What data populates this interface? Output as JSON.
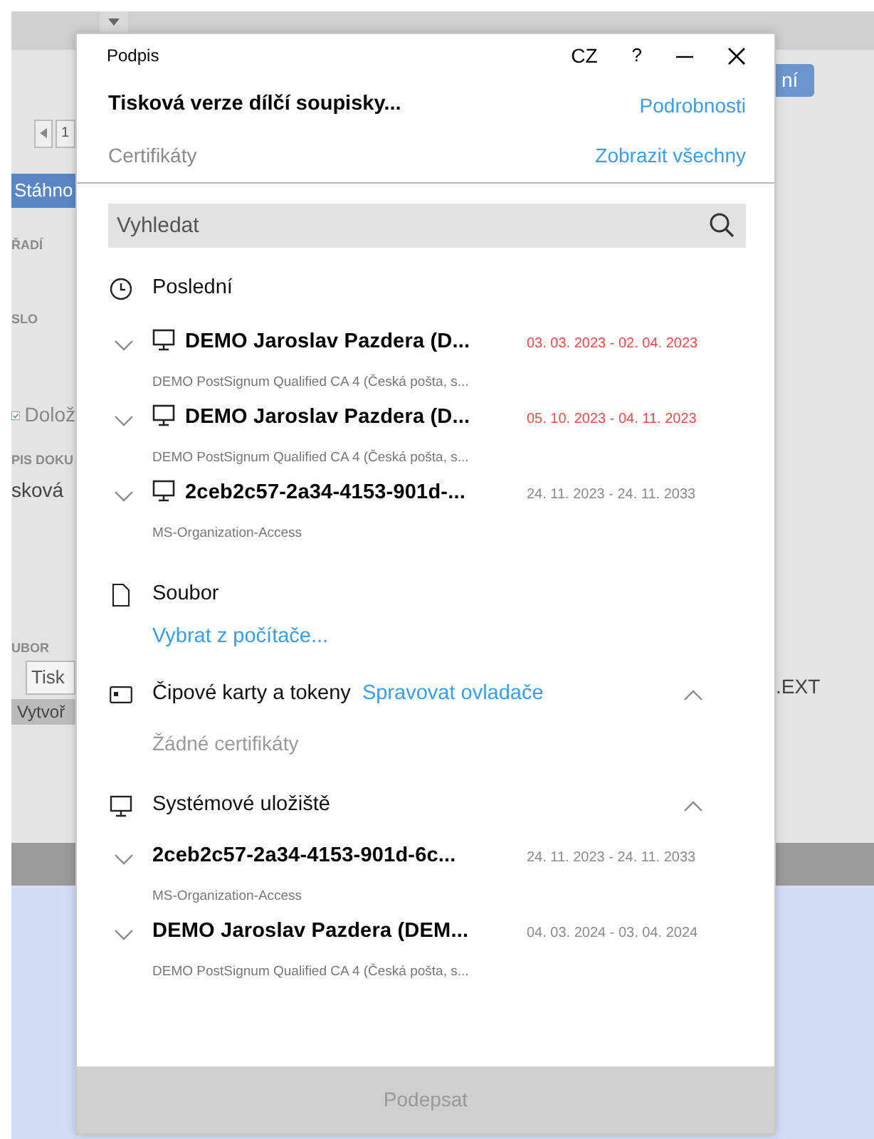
{
  "background": {
    "left": [
      {
        "kind": "pager",
        "text": "1"
      },
      {
        "kind": "button",
        "text": "Stáhno"
      },
      {
        "kind": "label",
        "text": "ŘADÍ"
      },
      {
        "kind": "label",
        "text": "SLO"
      },
      {
        "kind": "checkbox",
        "text": "Dolož",
        "checked": true
      },
      {
        "kind": "label",
        "text": "PIS DOKU"
      },
      {
        "kind": "value",
        "text": "sková"
      },
      {
        "kind": "label",
        "text": "UBOR"
      },
      {
        "kind": "field",
        "text": "Tisk"
      },
      {
        "kind": "action",
        "text": "Vytvoř"
      }
    ],
    "right": [
      {
        "kind": "button",
        "text": "ní"
      },
      {
        "kind": "value",
        "text": ".EXT"
      }
    ]
  },
  "dialog": {
    "title": "Podpis",
    "language": "CZ",
    "help": "?",
    "document": "Tisková verze dílčí soupisky...",
    "details_link": "Podrobnosti",
    "certificates_label": "Certifikáty",
    "show_all_link": "Zobrazit všechny",
    "search": {
      "placeholder": "Vyhledat"
    },
    "sections": [
      {
        "kind": "recent",
        "title": "Poslední",
        "items": [
          {
            "name": "DEMO Jaroslav Pazdera (D...",
            "validity": "03. 03. 2023 - 02. 04. 2023",
            "expired": true,
            "issuer": "DEMO PostSignum Qualified CA 4 (Česká pošta, s..."
          },
          {
            "name": "DEMO Jaroslav Pazdera (D...",
            "validity": "05. 10. 2023 - 04. 11. 2023",
            "expired": true,
            "issuer": "DEMO PostSignum Qualified CA 4 (Česká pošta, s..."
          },
          {
            "name": "2ceb2c57-2a34-4153-901d-...",
            "validity": "24. 11. 2023 - 24. 11. 2033",
            "expired": false,
            "issuer": "MS-Organization-Access"
          }
        ]
      },
      {
        "kind": "file",
        "title": "Soubor",
        "link": "Vybrat z počítače..."
      },
      {
        "kind": "smartcard",
        "title": "Čipové karty a tokeny",
        "link": "Spravovat ovladače",
        "expanded": true,
        "empty": "Žádné certifikáty"
      },
      {
        "kind": "system",
        "title": "Systémové uložiště",
        "expanded": true,
        "items": [
          {
            "name": "2ceb2c57-2a34-4153-901d-6c...",
            "validity": "24. 11. 2023 - 24. 11. 2033",
            "expired": false,
            "issuer": "MS-Organization-Access"
          },
          {
            "name": "DEMO Jaroslav Pazdera (DEM...",
            "validity": "04. 03. 2024 - 03. 04. 2024",
            "expired": false,
            "issuer": "DEMO PostSignum Qualified CA 4 (Česká pošta, s..."
          }
        ]
      }
    ],
    "sign_button": {
      "label": "Podepsat",
      "disabled": true
    }
  }
}
